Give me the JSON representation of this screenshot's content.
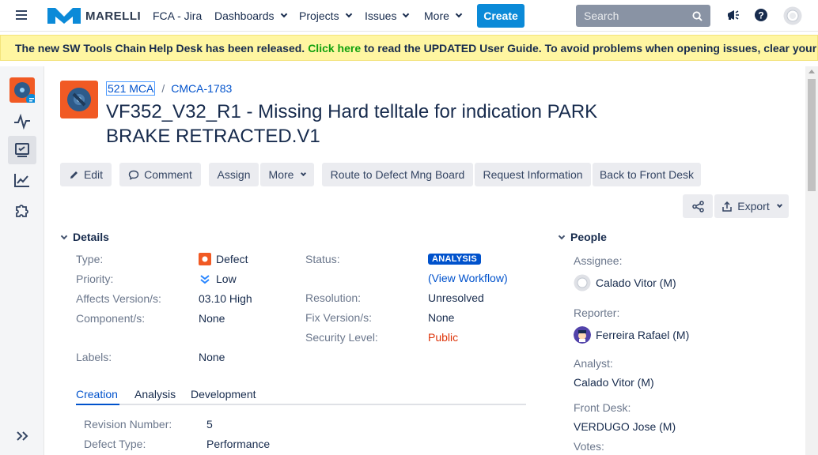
{
  "nav": {
    "logo_text": "MARELLI",
    "app_title": "FCA - Jira",
    "items": [
      {
        "label": "Dashboards"
      },
      {
        "label": "Projects"
      },
      {
        "label": "Issues"
      },
      {
        "label": "More"
      }
    ],
    "create_label": "Create",
    "search_placeholder": "Search",
    "accent": "#0b8ad8"
  },
  "banner": {
    "before": "The new SW Tools Chain Help Desk has been released. ",
    "link": "Click here",
    "after": " to read the UPDATED User Guide. To avoid problems when opening issues, clear your browser's"
  },
  "issue": {
    "project_key": "521 MCA",
    "issue_key": "CMCA-1783",
    "summary": "VF352_V32_R1 - Missing Hard telltale for indication PARK BRAKE RETRACTED.V1"
  },
  "actions": {
    "edit": "Edit",
    "comment": "Comment",
    "assign": "Assign",
    "more": "More",
    "route": "Route to Defect Mng Board",
    "request": "Request Information",
    "back": "Back to Front Desk",
    "export": "Export"
  },
  "details": {
    "title": "Details",
    "type_label": "Type:",
    "type_value": "Defect",
    "priority_label": "Priority:",
    "priority_value": "Low",
    "affects_label": "Affects Version/s:",
    "affects_value": "03.10 High",
    "component_label": "Component/s:",
    "component_value": "None",
    "labels_label": "Labels:",
    "labels_value": "None",
    "status_label": "Status:",
    "status_value": "ANALYSIS",
    "view_workflow": "(View Workflow)",
    "resolution_label": "Resolution:",
    "resolution_value": "Unresolved",
    "fix_label": "Fix Version/s:",
    "fix_value": "None",
    "security_label": "Security Level:",
    "security_value": "Public"
  },
  "tabs": {
    "creation": "Creation",
    "analysis": "Analysis",
    "development": "Development"
  },
  "creation": {
    "revision_label": "Revision Number:",
    "revision_value": "5",
    "defect_type_label": "Defect Type:",
    "defect_type_value": "Performance"
  },
  "people": {
    "title": "People",
    "assignee_label": "Assignee:",
    "assignee_value": "Calado Vitor (M)",
    "reporter_label": "Reporter:",
    "reporter_value": "Ferreira Rafael (M)",
    "analyst_label": "Analyst:",
    "analyst_value": "Calado Vitor (M)",
    "frontdesk_label": "Front Desk:",
    "frontdesk_value": "VERDUGO Jose (M)",
    "votes_label": "Votes:"
  }
}
